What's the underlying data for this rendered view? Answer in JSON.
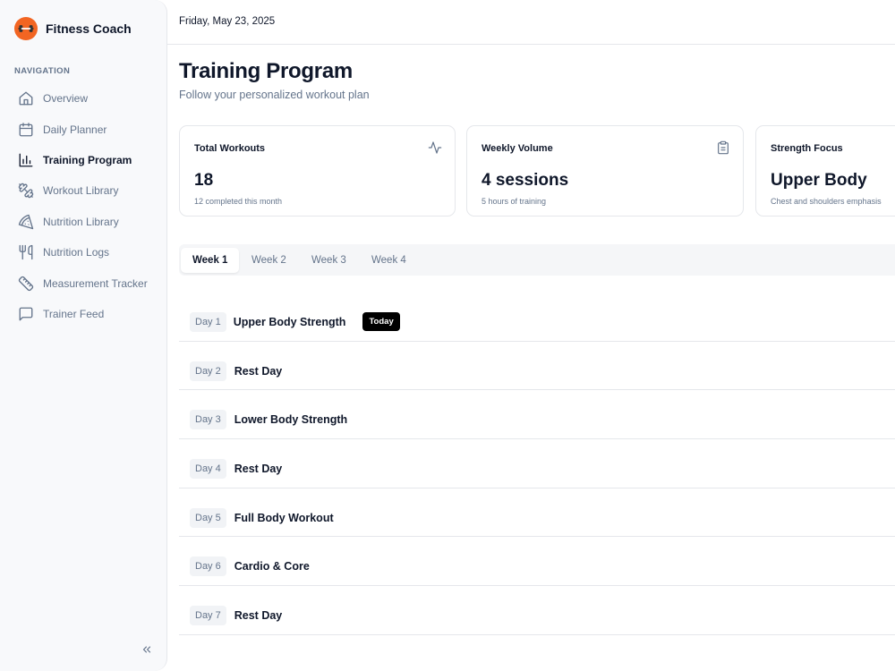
{
  "app": {
    "name": "Fitness Coach",
    "logo_icon": "dumbbell-icon",
    "brand_color": "#f26522"
  },
  "sidebar": {
    "heading": "NAVIGATION",
    "items": [
      {
        "label": "Overview",
        "icon": "home-icon",
        "active": false
      },
      {
        "label": "Daily Planner",
        "icon": "calendar-icon",
        "active": false
      },
      {
        "label": "Training Program",
        "icon": "bar-chart-icon",
        "active": true
      },
      {
        "label": "Workout Library",
        "icon": "dumbbell-icon",
        "active": false
      },
      {
        "label": "Nutrition Library",
        "icon": "pizza-icon",
        "active": false
      },
      {
        "label": "Nutrition Logs",
        "icon": "utensils-icon",
        "active": false
      },
      {
        "label": "Measurement Tracker",
        "icon": "ruler-icon",
        "active": false
      },
      {
        "label": "Trainer Feed",
        "icon": "message-square-icon",
        "active": false
      }
    ],
    "collapse_icon": "chevrons-left-icon"
  },
  "header": {
    "date": "Friday, May 23, 2025"
  },
  "page": {
    "title": "Training Program",
    "subtitle": "Follow your personalized workout plan"
  },
  "stats": [
    {
      "title": "Total Workouts",
      "value": "18",
      "note": "12 completed this month",
      "icon": "activity-icon"
    },
    {
      "title": "Weekly Volume",
      "value": "4 sessions",
      "note": "5 hours of training",
      "icon": "clipboard-icon"
    },
    {
      "title": "Strength Focus",
      "value": "Upper Body",
      "note": "Chest and shoulders emphasis",
      "icon": ""
    }
  ],
  "tabs": [
    {
      "label": "Week 1",
      "active": true
    },
    {
      "label": "Week 2",
      "active": false
    },
    {
      "label": "Week 3",
      "active": false
    },
    {
      "label": "Week 4",
      "active": false
    }
  ],
  "days": [
    {
      "day": "Day 1",
      "title": "Upper Body Strength",
      "badge": "Today"
    },
    {
      "day": "Day 2",
      "title": "Rest Day",
      "badge": ""
    },
    {
      "day": "Day 3",
      "title": "Lower Body Strength",
      "badge": ""
    },
    {
      "day": "Day 4",
      "title": "Rest Day",
      "badge": ""
    },
    {
      "day": "Day 5",
      "title": "Full Body Workout",
      "badge": ""
    },
    {
      "day": "Day 6",
      "title": "Cardio & Core",
      "badge": ""
    },
    {
      "day": "Day 7",
      "title": "Rest Day",
      "badge": ""
    }
  ]
}
